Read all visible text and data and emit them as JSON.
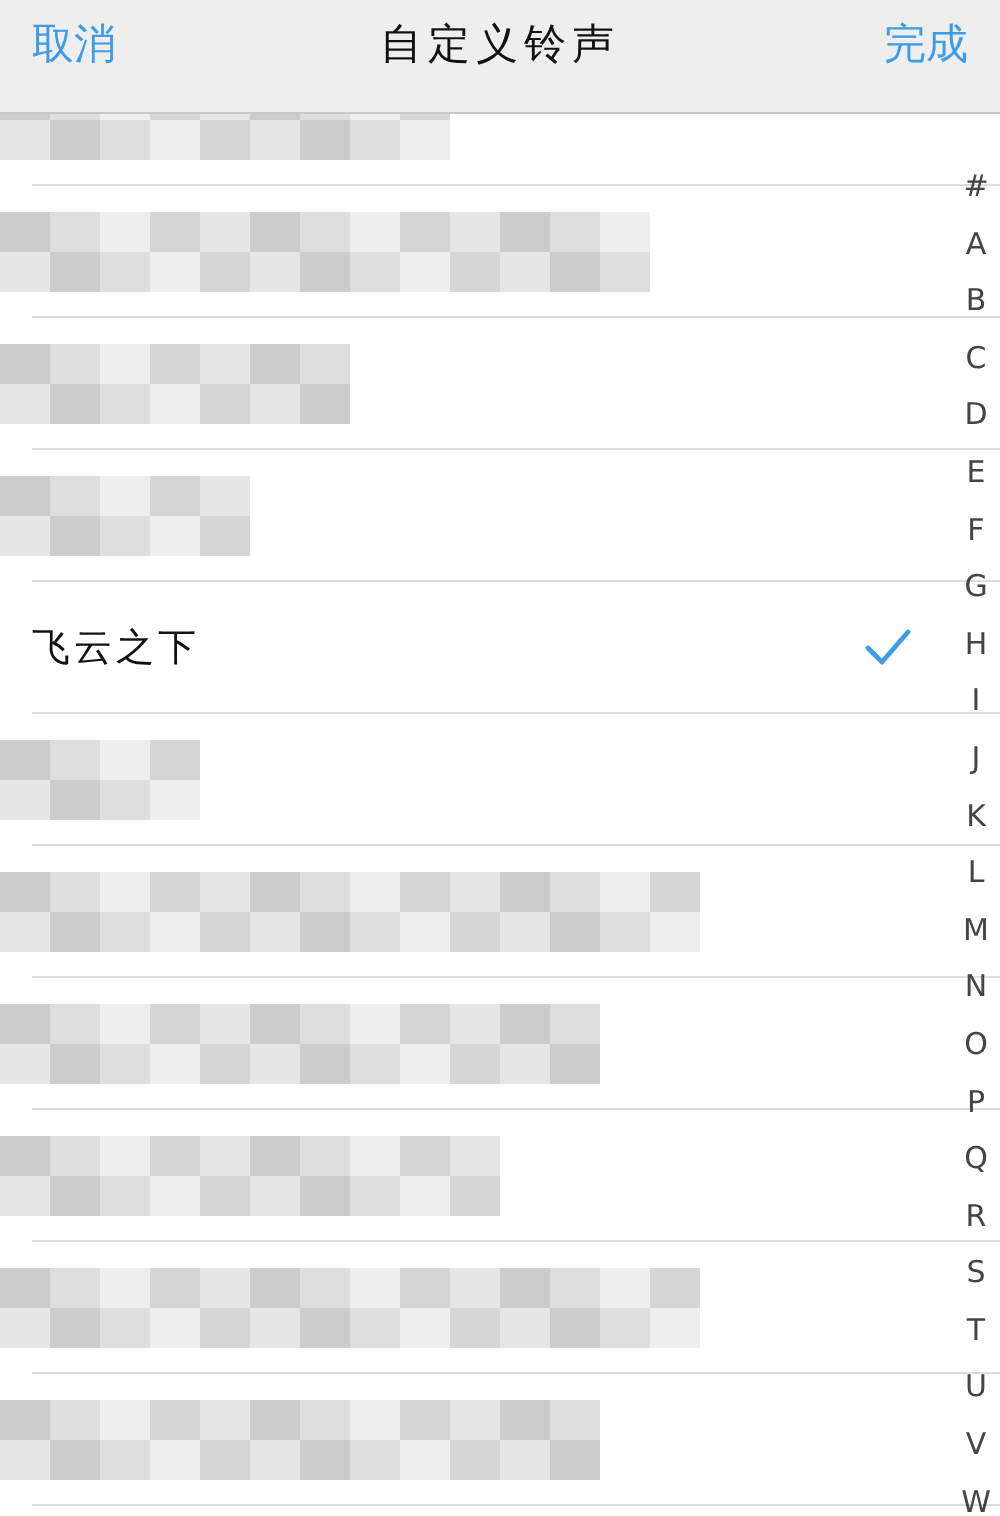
{
  "nav_bar": {
    "cancel": "取消",
    "title": "自定义铃声",
    "done": "完成"
  },
  "rows": [
    {
      "kind": "pixelated",
      "selected": false
    },
    {
      "kind": "pixelated",
      "selected": false
    },
    {
      "kind": "pixelated",
      "selected": false
    },
    {
      "kind": "pixelated",
      "selected": false
    },
    {
      "kind": "song",
      "title": "飞云之下",
      "selected": true
    },
    {
      "kind": "pixelated",
      "selected": false
    },
    {
      "kind": "pixelated",
      "selected": false
    },
    {
      "kind": "pixelated",
      "selected": false
    },
    {
      "kind": "pixelated",
      "selected": false
    },
    {
      "kind": "pixelated",
      "selected": false
    },
    {
      "kind": "pixelated",
      "selected": false
    }
  ],
  "section_index": [
    "#",
    "A",
    "B",
    "C",
    "D",
    "E",
    "F",
    "G",
    "H",
    "I",
    "J",
    "K",
    "L",
    "M",
    "N",
    "O",
    "P",
    "Q",
    "R",
    "S",
    "T",
    "U",
    "V",
    "W"
  ]
}
